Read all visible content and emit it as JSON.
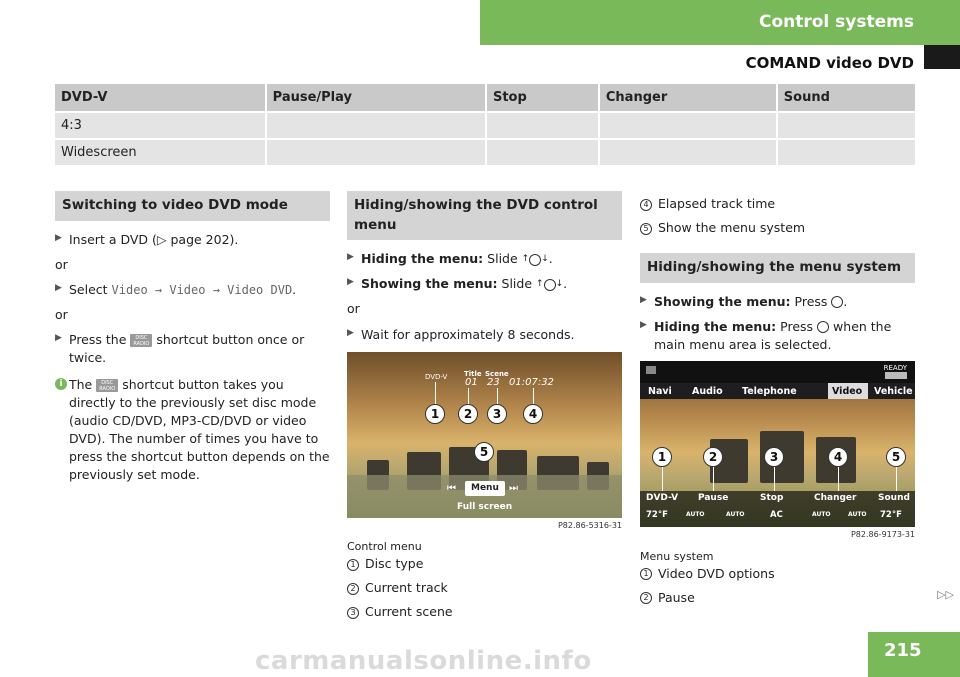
{
  "header": {
    "section": "Control systems",
    "subsection": "COMAND video DVD"
  },
  "table": {
    "headers": [
      "DVD-V",
      "Pause/Play",
      "Stop",
      "Changer",
      "Sound"
    ],
    "rows": [
      [
        "4:3",
        "",
        "",
        "",
        ""
      ],
      [
        "Widescreen",
        "",
        "",
        "",
        ""
      ]
    ]
  },
  "col1": {
    "heading": "Switching to video DVD mode",
    "step1": "Insert a DVD (▷ page 202).",
    "or1": "or",
    "step2_prefix": "Select",
    "step2_path": "Video → Video → Video DVD",
    "step2_suffix": ".",
    "or2": "or",
    "step3_a": "Press the",
    "step3_b": "shortcut button once or twice.",
    "info_a": "The",
    "info_b": "shortcut button takes you directly to the previously set disc mode (audio CD/DVD, MP3-CD/DVD or video DVD). The number of times you have to press the shortcut button depends on the previously set mode.",
    "disc_icon_line1": "DISC",
    "disc_icon_line2": "RADIO"
  },
  "col2": {
    "heading": "Hiding/showing the DVD control menu",
    "step1_bold": "Hiding the menu:",
    "step1_rest": "Slide",
    "step2_bold": "Showing the menu:",
    "step2_rest": "Slide",
    "or": "or",
    "step3": "Wait for approximately 8 seconds.",
    "image": {
      "label_dvdv": "DVD-V",
      "label_title": "Title",
      "label_scene": "Scene",
      "title_val": "01",
      "scene_val": "23",
      "time_val": "01:07:32",
      "menu_label": "Menu",
      "fullscreen": "Full screen",
      "code": "P82.86-5316-31",
      "callouts": [
        "1",
        "2",
        "3",
        "4",
        "5"
      ]
    },
    "caption": "Control menu",
    "items": [
      {
        "n": "1",
        "text": "Disc type"
      },
      {
        "n": "2",
        "text": "Current track"
      },
      {
        "n": "3",
        "text": "Current scene"
      }
    ]
  },
  "col3": {
    "items_top": [
      {
        "n": "4",
        "text": "Elapsed track time"
      },
      {
        "n": "5",
        "text": "Show the menu system"
      }
    ],
    "heading": "Hiding/showing the menu system",
    "step1_bold": "Showing the menu:",
    "step1_rest": "Press",
    "step2_bold": "Hiding the menu:",
    "step2_rest": "Press",
    "step2_tail": "when the main menu area is selected.",
    "image": {
      "ready": "READY",
      "tabs": [
        "Navi",
        "Audio",
        "Telephone",
        "Video",
        "Vehicle"
      ],
      "bottom": [
        "DVD-V",
        "Pause",
        "Stop",
        "Changer",
        "Sound"
      ],
      "temp_left": "72°F",
      "temp_right": "72°F",
      "ac": "AC",
      "auto": "AUTO",
      "code": "P82.86-9173-31",
      "callouts": [
        "1",
        "2",
        "3",
        "4",
        "5"
      ]
    },
    "caption": "Menu system",
    "items": [
      {
        "n": "1",
        "text": "Video DVD options"
      },
      {
        "n": "2",
        "text": "Pause"
      }
    ]
  },
  "footer": {
    "continue": "▷▷",
    "page": "215",
    "watermark": "carmanualsonline.info"
  },
  "colors": {
    "accent_green": "#79b95a",
    "section_gray": "#d4d4d4"
  }
}
